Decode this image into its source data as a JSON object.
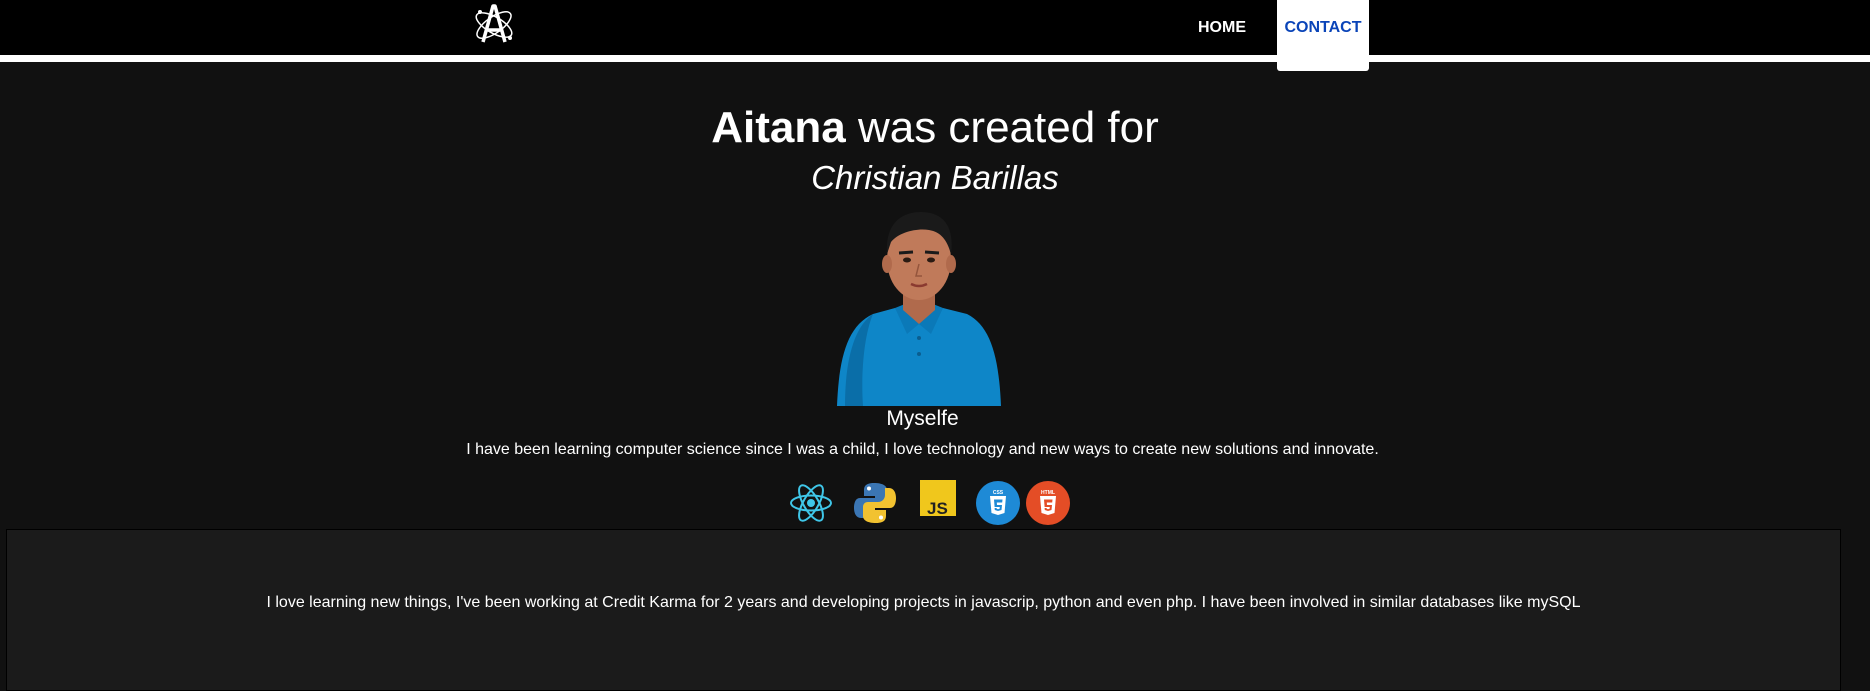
{
  "colors": {
    "page_bg": "#111111",
    "topbar_bg": "#000000",
    "contact_active_text": "#0a44b8",
    "panel_bg": "#1b1b1b"
  },
  "nav": {
    "logo_icon": "atom-letter-a-logo-icon",
    "items": [
      {
        "label": "HOME",
        "active": false
      },
      {
        "label": "CONTACT",
        "active": true
      }
    ]
  },
  "hero": {
    "name": "Aitana",
    "created_for": " was created for",
    "person": "Christian Barillas",
    "portrait": "portrait-photo",
    "caption": "Myselfe",
    "bio": "I have been learning computer science since I was a child, I love technology and new ways to create new solutions and innovate."
  },
  "tech_icons": [
    "react-icon",
    "python-icon",
    "javascript-icon",
    "css3-icon",
    "html5-icon"
  ],
  "panel": {
    "text": "I love learning new things, I've been working at Credit Karma for 2 years and developing projects in javascrip, python and even php. I have been involved in similar databases like mySQL"
  }
}
